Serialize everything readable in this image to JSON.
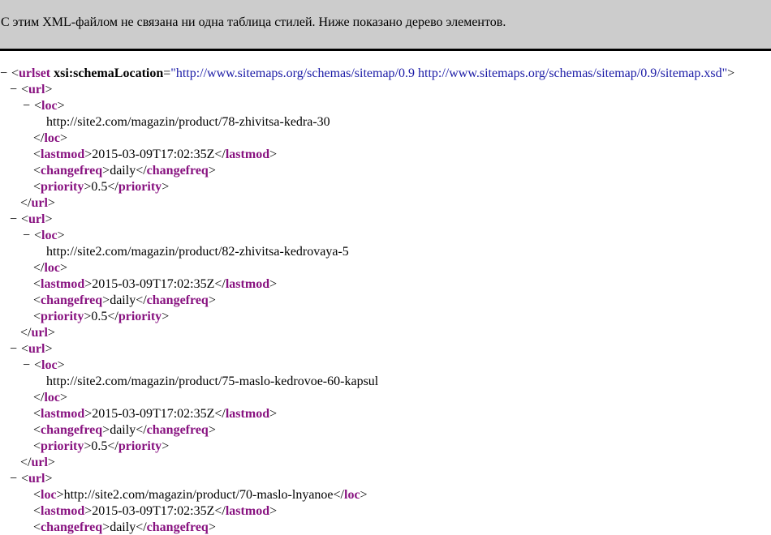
{
  "header": {
    "message": "С этим XML-файлом не связана ни одна таблица стилей. Ниже показано дерево элементов."
  },
  "toggle_glyph": "−",
  "root": {
    "tag": "urlset",
    "attr_name": "xsi:schemaLocation",
    "attr_value": "\"http://www.sitemaps.org/schemas/sitemap/0.9 http://www.sitemaps.org/schemas/sitemap/0.9/sitemap.xsd\""
  },
  "entries": [
    {
      "loc": "http://site2.com/magazin/product/78-zhivitsa-kedra-30",
      "lastmod": "2015-03-09T17:02:35Z",
      "changefreq": "daily",
      "priority": "0.5"
    },
    {
      "loc": "http://site2.com/magazin/product/82-zhivitsa-kedrovaya-5",
      "lastmod": "2015-03-09T17:02:35Z",
      "changefreq": "daily",
      "priority": "0.5"
    },
    {
      "loc": "http://site2.com/magazin/product/75-maslo-kedrovoe-60-kapsul",
      "lastmod": "2015-03-09T17:02:35Z",
      "changefreq": "daily",
      "priority": "0.5"
    },
    {
      "loc": "http://site2.com/magazin/product/70-maslo-lnyanoe",
      "lastmod": "2015-03-09T17:02:35Z",
      "changefreq": "daily"
    }
  ],
  "tags": {
    "url": "url",
    "loc": "loc",
    "lastmod": "lastmod",
    "changefreq": "changefreq",
    "priority": "priority"
  }
}
